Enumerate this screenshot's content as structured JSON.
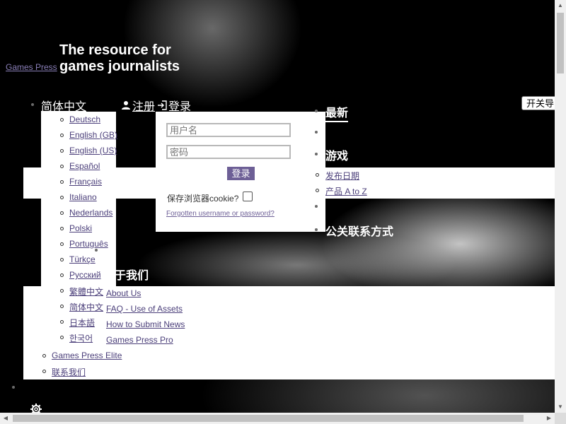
{
  "header": {
    "logo_text": "Games Press",
    "tagline": "The resource for games journalists"
  },
  "top_nav": {
    "current_language": "简体中文",
    "register_label": "注册",
    "login_label": "登录",
    "toggle_button_label": "开关导"
  },
  "languages": [
    "Deutsch",
    "English (GB)",
    "English (US)",
    "Español",
    "Français",
    "Italiano",
    "Nederlands",
    "Polski",
    "Português",
    "Türkçe",
    "Русский",
    "繁體中文",
    "简体中文",
    "日本語",
    "한국어"
  ],
  "login_form": {
    "username_placeholder": "用户名",
    "password_placeholder": "密码",
    "submit_label": "登录",
    "remember_label": "保存浏览器cookie?",
    "remember_checked": false,
    "forgot_link": "Forgotten username or password?"
  },
  "main_nav": {
    "latest": "最新",
    "games": "游戏",
    "games_items": [
      "发布日期",
      "产品 A to Z"
    ],
    "pr": "公关联系方式",
    "about": "关于我们",
    "about_items": [
      "About Us",
      "FAQ - Use of Assets",
      "How to Submit News",
      "Games Press Pro"
    ],
    "extra_items": [
      "Games Press Elite",
      "联系我们"
    ]
  },
  "icons": {
    "user": "user-icon",
    "login": "login-icon",
    "settings": "gear-icon"
  },
  "colors": {
    "accent": "#6d5f96",
    "link": "#4b3f7a",
    "background": "#000000"
  }
}
